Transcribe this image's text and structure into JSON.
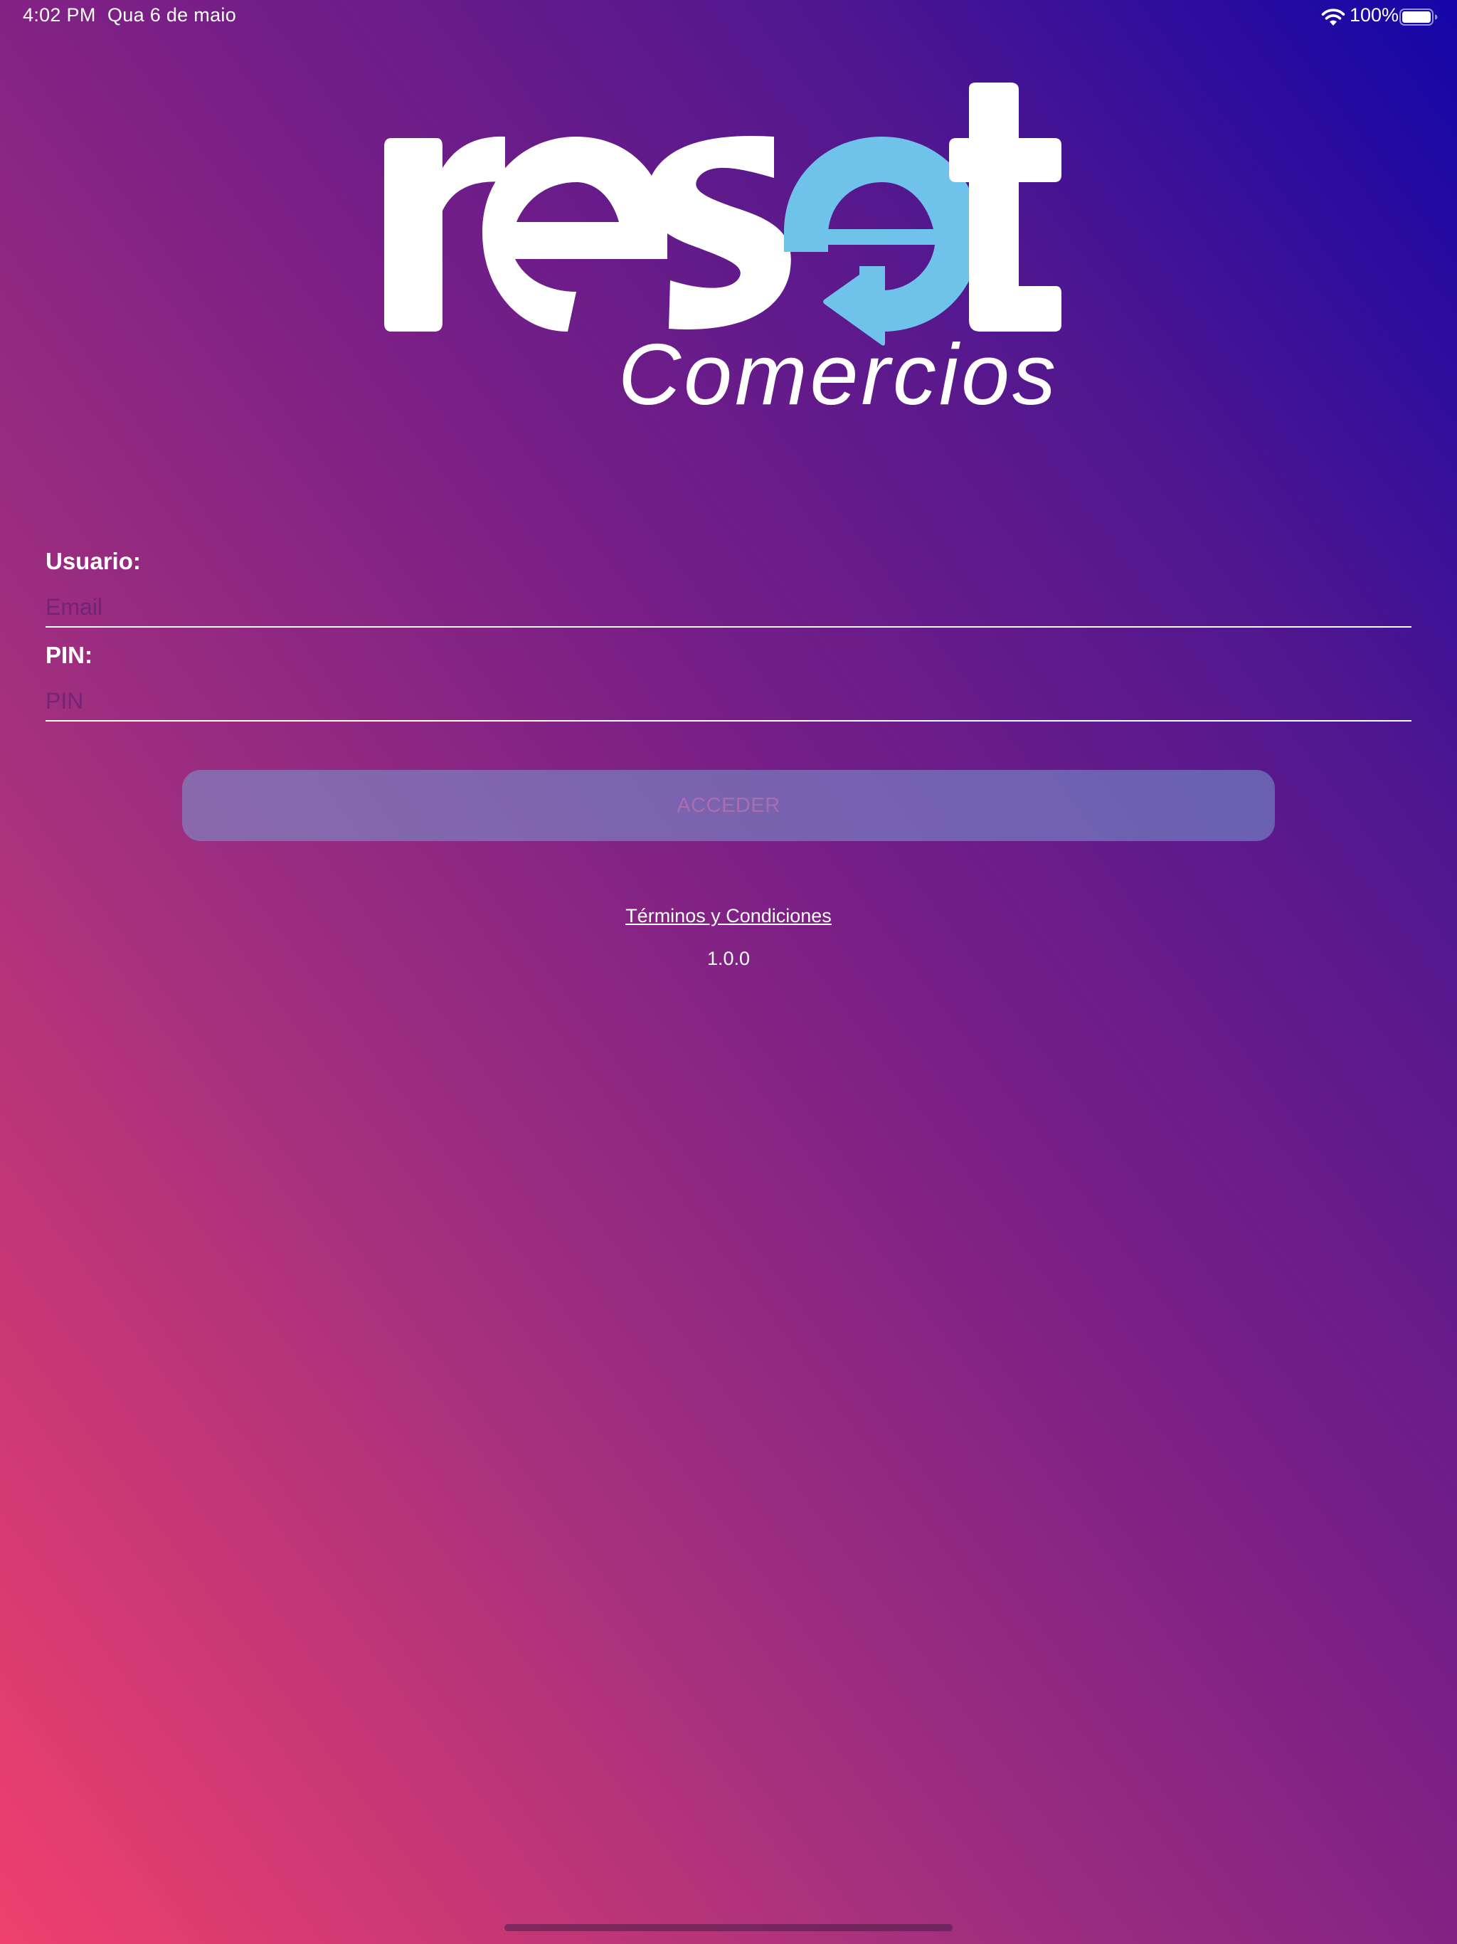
{
  "status_bar": {
    "time": "4:02 PM",
    "date": "Qua 6 de maio",
    "battery_percent": "100%",
    "battery_level": 1.0
  },
  "logo": {
    "wordmark": "reset",
    "subtitle": "Comercios",
    "accent_color": "#6fc3ea"
  },
  "login_form": {
    "user_label": "Usuario:",
    "user_placeholder": "Email",
    "user_value": "",
    "pin_label": "PIN:",
    "pin_placeholder": "PIN",
    "pin_value": "",
    "submit_label": "ACCEDER"
  },
  "footer": {
    "terms_link": "Términos y Condiciones",
    "version": "1.0.0"
  },
  "colors": {
    "gradient_bottom_left": "#ef406c",
    "gradient_top_right": "#1306a8",
    "text": "#ffffff"
  }
}
